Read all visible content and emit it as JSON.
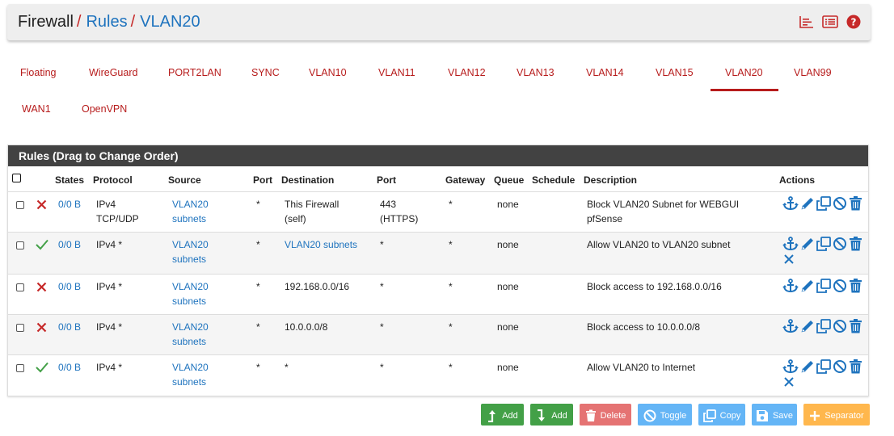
{
  "breadcrumb": {
    "root": "Firewall",
    "sep": "/",
    "rules": "Rules",
    "current": "VLAN20"
  },
  "header_icons": [
    "chart-icon",
    "list-icon",
    "help-icon"
  ],
  "tabs": [
    "Floating",
    "WireGuard",
    "PORT2LAN",
    "SYNC",
    "VLAN10",
    "VLAN11",
    "VLAN12",
    "VLAN13",
    "VLAN14",
    "VLAN15",
    "VLAN20",
    "VLAN99",
    "WAN1",
    "OpenVPN"
  ],
  "active_tab": "VLAN20",
  "panel": {
    "title": "Rules (Drag to Change Order)"
  },
  "columns": [
    "States",
    "Protocol",
    "Source",
    "Port",
    "Destination",
    "Port",
    "Gateway",
    "Queue",
    "Schedule",
    "Description",
    "Actions"
  ],
  "rules": [
    {
      "action": "block",
      "states": "0/0 B",
      "protocol": [
        "IPv4",
        "TCP/UDP"
      ],
      "source": [
        "VLAN20",
        "subnets"
      ],
      "sport": "*",
      "destination": [
        "This Firewall",
        "(self)"
      ],
      "dest_is_link": false,
      "dport": [
        "443",
        "(HTTPS)"
      ],
      "gateway": "*",
      "queue": "none",
      "schedule": "",
      "description": [
        "Block VLAN20 Subnet for WEBGUI",
        "pfSense"
      ],
      "extra_delete": false
    },
    {
      "action": "pass",
      "states": "0/0 B",
      "protocol": [
        "IPv4 *"
      ],
      "source": [
        "VLAN20",
        "subnets"
      ],
      "sport": "*",
      "destination": [
        "VLAN20 subnets"
      ],
      "dest_is_link": true,
      "dport": [
        "*"
      ],
      "gateway": "*",
      "queue": "none",
      "schedule": "",
      "description": [
        "Allow VLAN20 to VLAN20 subnet"
      ],
      "extra_delete": true
    },
    {
      "action": "block",
      "states": "0/0 B",
      "protocol": [
        "IPv4 *"
      ],
      "source": [
        "VLAN20",
        "subnets"
      ],
      "sport": "*",
      "destination": [
        "192.168.0.0/16"
      ],
      "dest_is_link": false,
      "dport": [
        "*"
      ],
      "gateway": "*",
      "queue": "none",
      "schedule": "",
      "description": [
        "Block access to 192.168.0.0/16"
      ],
      "extra_delete": false
    },
    {
      "action": "block",
      "states": "0/0 B",
      "protocol": [
        "IPv4 *"
      ],
      "source": [
        "VLAN20",
        "subnets"
      ],
      "sport": "*",
      "destination": [
        "10.0.0.0/8"
      ],
      "dest_is_link": false,
      "dport": [
        "*"
      ],
      "gateway": "*",
      "queue": "none",
      "schedule": "",
      "description": [
        "Block access to 10.0.0.0/8"
      ],
      "extra_delete": false
    },
    {
      "action": "pass",
      "states": "0/0 B",
      "protocol": [
        "IPv4 *"
      ],
      "source": [
        "VLAN20",
        "subnets"
      ],
      "sport": "*",
      "destination": [
        "*"
      ],
      "dest_is_link": false,
      "dport": [
        "*"
      ],
      "gateway": "*",
      "queue": "none",
      "schedule": "",
      "description": [
        "Allow VLAN20 to Internet"
      ],
      "extra_delete": true
    }
  ],
  "buttons": [
    {
      "label": "Add",
      "color": "#43a047",
      "icon": "add-top-icon"
    },
    {
      "label": "Add",
      "color": "#43a047",
      "icon": "add-bottom-icon"
    },
    {
      "label": "Delete",
      "color": "#e57373",
      "icon": "trash-icon"
    },
    {
      "label": "Toggle",
      "color": "#64b5f6",
      "icon": "ban-icon"
    },
    {
      "label": "Copy",
      "color": "#64b5f6",
      "icon": "copy-icon"
    },
    {
      "label": "Save",
      "color": "#64b5f6",
      "icon": "save-icon"
    },
    {
      "label": "Separator",
      "color": "#ffb74d",
      "icon": "plus-icon"
    }
  ],
  "colors": {
    "accent": "#b71c1c",
    "link": "#1e73be",
    "pass": "#43a047",
    "block": "#c62828",
    "panel_head": "#424242"
  }
}
